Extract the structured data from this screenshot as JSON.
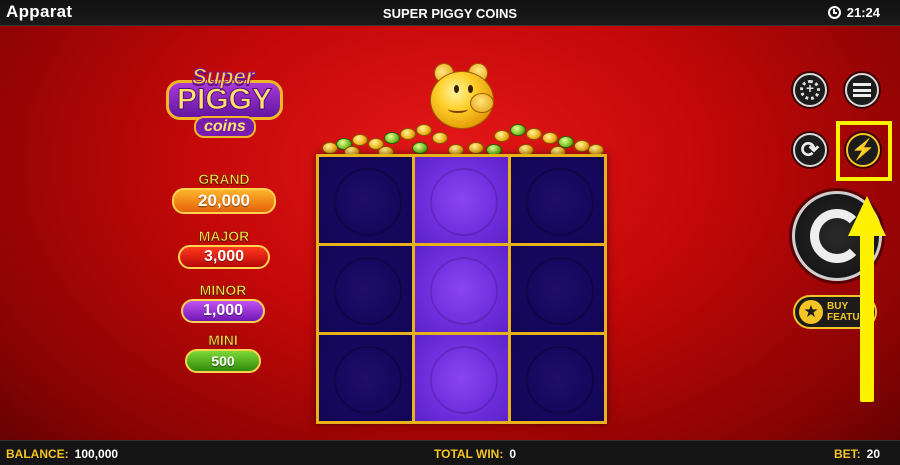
{
  "header": {
    "brand": "Apparat",
    "title": "SUPER PIGGY COINS",
    "time": "21:24"
  },
  "logo": {
    "line1": "Super",
    "line2": "PIGGY",
    "line3": "coins"
  },
  "jackpots": {
    "grand": {
      "label": "GRAND",
      "value": "20,000"
    },
    "major": {
      "label": "MAJOR",
      "value": "3,000"
    },
    "minor": {
      "label": "MINOR",
      "value": "1,000"
    },
    "mini": {
      "label": "MINI",
      "value": "500"
    }
  },
  "reels": {
    "rows": 3,
    "cols": 3,
    "highlighted_column": 2
  },
  "controls": {
    "bet_chip_icon": "chip-icon",
    "menu_icon": "hamburger-icon",
    "autoplay_icon": "refresh-icon",
    "turbo_icon": "lightning-bolt-icon",
    "spin_icon": "spin-icon",
    "buy_feature_line1": "BUY",
    "buy_feature_line2": "FEATURE"
  },
  "footer": {
    "balance_label": "BALANCE:",
    "balance_value": "100,000",
    "total_win_label": "TOTAL WIN:",
    "total_win_value": "0",
    "bet_label": "BET:",
    "bet_value": "20"
  },
  "colors": {
    "accent_gold": "#f4c524",
    "annotation_yellow": "#fff200",
    "background_red": "#c40808",
    "reel_dark": "#170860",
    "reel_highlight": "#7230e0"
  }
}
